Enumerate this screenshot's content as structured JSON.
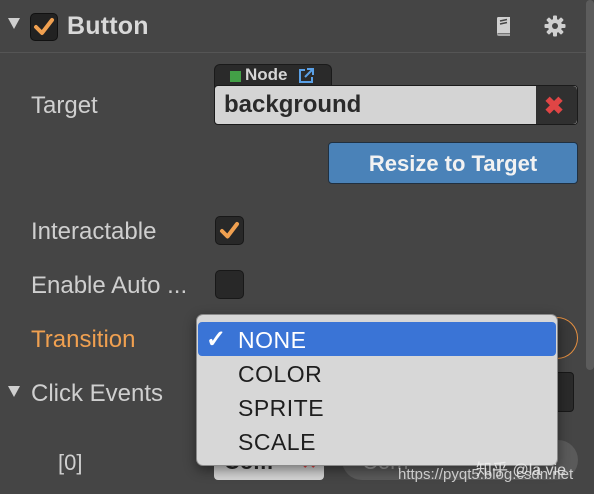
{
  "header": {
    "title": "Button",
    "enabled": true,
    "icons": [
      "collapse-triangle-icon",
      "book-icon",
      "gear-icon"
    ]
  },
  "target": {
    "label": "Target",
    "node_badge": "Node",
    "value": "background",
    "clear_glyph": "✖"
  },
  "resize_button": {
    "label": "Resize to Target"
  },
  "interactable": {
    "label": "Interactable",
    "checked": true
  },
  "enable_auto": {
    "label": "Enable Auto ...",
    "checked": false
  },
  "transition": {
    "label": "Transition",
    "options": [
      "NONE",
      "COLOR",
      "SPRITE",
      "SCALE"
    ],
    "selected": "NONE",
    "check_glyph": "✓"
  },
  "click_events": {
    "label": "Click Events",
    "row_index": "[0]",
    "row_value": "Com",
    "row_clear_glyph": "✖",
    "component_text": "Com"
  },
  "watermark": {
    "line1": "知乎 @la vie",
    "line2": "https://pyqt5.blog.csdn.net"
  },
  "colors": {
    "background": "#454545",
    "accent_orange": "#f0a050",
    "resize_blue": "#4a82b8",
    "selection_blue": "#3a74d6",
    "clear_red": "#e04545",
    "node_green": "#43a047"
  }
}
